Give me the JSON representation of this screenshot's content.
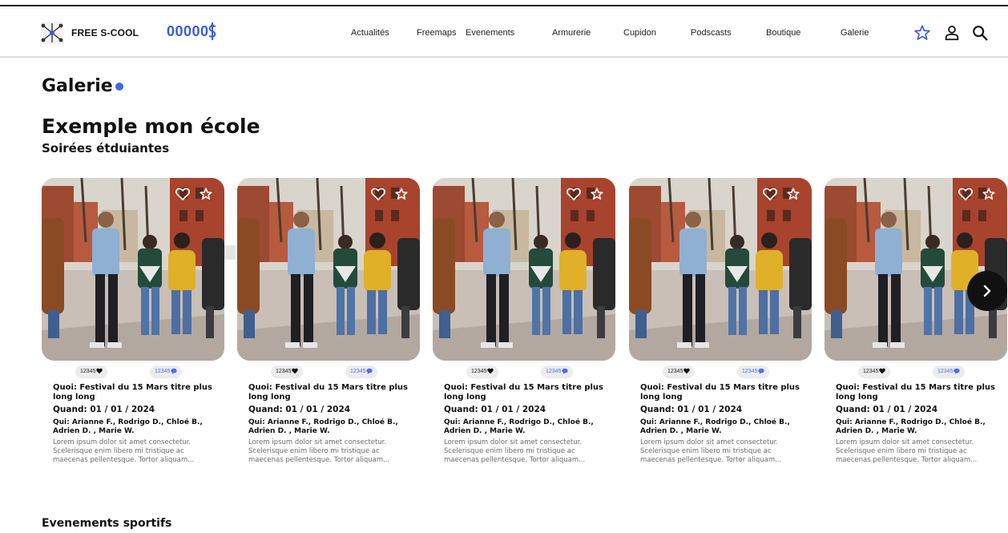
{
  "header": {
    "brand": "FREE S-COOL",
    "points": "00000",
    "nav": [
      "Actualités",
      "Freemaps",
      "Evenements",
      "Armurerie",
      "Cupidon",
      "Podscasts",
      "Boutique",
      "Galerie"
    ],
    "icons": [
      "star-icon",
      "user-icon",
      "search-icon"
    ]
  },
  "page": {
    "title": "Galerie",
    "school": "Exemple mon école",
    "section1": "Soirées étduiantes",
    "section2": "Evenements sportifs"
  },
  "cards": [
    {
      "likes": "12345",
      "comments": "12345",
      "quoi": "Quoi: Festival du 15 Mars titre plus long long",
      "quand": "Quand: 01 / 01 / 2024",
      "qui": "Qui: Arianne F.,  Rodrigo D., Chloé B., Adrien D. , Marie W.",
      "desc": "Lorem ipsum dolor sit amet consectetur. Scelerisque enim libero mi tristique ac maecenas pellentesque. Tortor aliquam..."
    },
    {
      "likes": "12345",
      "comments": "12345",
      "quoi": "Quoi: Festival du 15 Mars titre plus long long",
      "quand": "Quand: 01 / 01 / 2024",
      "qui": "Qui: Arianne F.,  Rodrigo D., Chloé B., Adrien D. , Marie W.",
      "desc": "Lorem ipsum dolor sit amet consectetur. Scelerisque enim libero mi tristique ac maecenas pellentesque. Tortor aliquam..."
    },
    {
      "likes": "12345",
      "comments": "12345",
      "quoi": "Quoi: Festival du 15 Mars titre plus long long",
      "quand": "Quand: 01 / 01 / 2024",
      "qui": "Qui: Arianne F.,  Rodrigo D., Chloé B., Adrien D. , Marie W.",
      "desc": "Lorem ipsum dolor sit amet consectetur. Scelerisque enim libero mi tristique ac maecenas pellentesque. Tortor aliquam..."
    },
    {
      "likes": "12345",
      "comments": "12345",
      "quoi": "Quoi: Festival du 15 Mars titre plus long long",
      "quand": "Quand: 01 / 01 / 2024",
      "qui": "Qui: Arianne F.,  Rodrigo D., Chloé B., Adrien D. , Marie W.",
      "desc": "Lorem ipsum dolor sit amet consectetur. Scelerisque enim libero mi tristique ac maecenas pellentesque. Tortor aliquam..."
    },
    {
      "likes": "12345",
      "comments": "12345",
      "quoi": "Quoi: Festival du 15 Mars titre plus long long",
      "quand": "Quand: 01 / 01 / 2024",
      "qui": "Qui: Arianne F.,  Rodrigo D., Chloé B., Adrien D. , Marie W.",
      "desc": "Lorem ipsum dolor sit amet consectetur. Scelerisque enim libero mi tristique ac maecenas pellentesque. Tortor aliquam..."
    }
  ],
  "colors": {
    "accent": "#4169e1",
    "points": "#3b5bdb",
    "comment": "#4c6ef5"
  }
}
